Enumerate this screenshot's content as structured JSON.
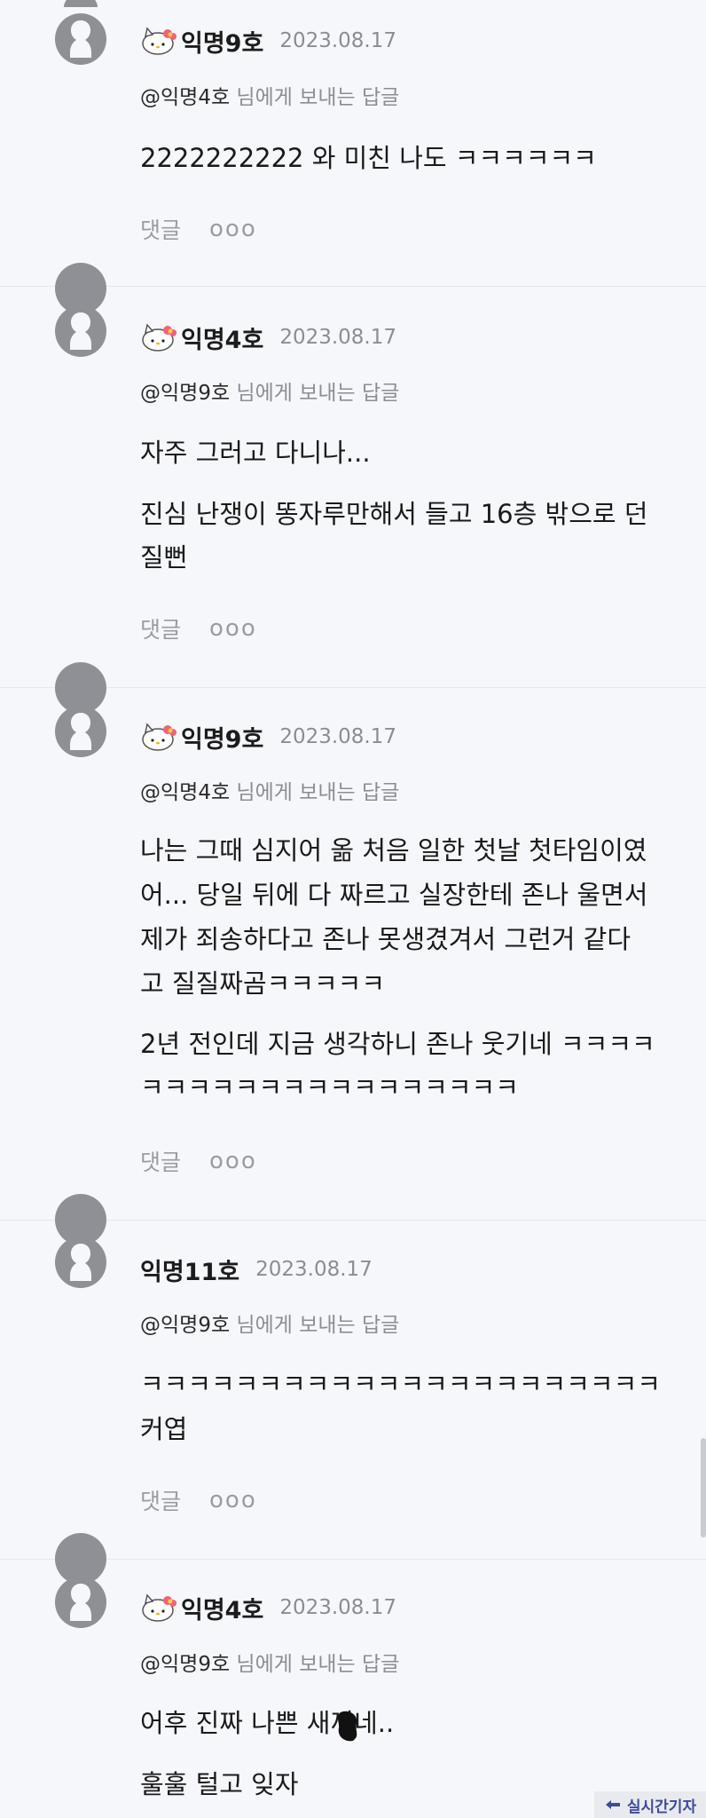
{
  "comments": [
    {
      "nickname": "익명9호",
      "date": "2023.08.17",
      "has_badge": true,
      "reply_to": "@익명4호",
      "reply_suffix": " 님에게 보내는 답글",
      "lines": [
        "2222222222 와 미친 나도 ㅋㅋㅋㅋㅋㅋ"
      ],
      "reply_label": "댓글",
      "more_label": "ooo"
    },
    {
      "nickname": "익명4호",
      "date": "2023.08.17",
      "has_badge": true,
      "reply_to": "@익명9호",
      "reply_suffix": " 님에게 보내는 답글",
      "lines": [
        "자주 그러고 다니나...",
        "진심 난쟁이 똥자루만해서 들고 16층 밖으로 던",
        "질뻔"
      ],
      "reply_label": "댓글",
      "more_label": "ooo"
    },
    {
      "nickname": "익명9호",
      "date": "2023.08.17",
      "has_badge": true,
      "reply_to": "@익명4호",
      "reply_suffix": " 님에게 보내는 답글",
      "lines": [
        "나는 그때 심지어 옮 처음 일한 첫날 첫타임이였",
        "어... 당일 뒤에 다 짜르고 실장한테 존나 울면서",
        "제가 죄송하다고 존나 못생겼겨서 그런거 같다",
        "고 질질짜곰ㅋㅋㅋㅋㅋ",
        "2년 전인데 지금 생각하니 존나 웃기네 ㅋㅋㅋㅋ",
        "ㅋㅋㅋㅋㅋㅋㅋㅋㅋㅋㅋㅋㅋㅋㅋㅋ"
      ],
      "reply_label": "댓글",
      "more_label": "ooo"
    },
    {
      "nickname": "익명11호",
      "date": "2023.08.17",
      "has_badge": false,
      "reply_to": "@익명9호",
      "reply_suffix": " 님에게 보내는 답글",
      "lines": [
        "ㅋㅋㅋㅋㅋㅋㅋㅋㅋㅋㅋㅋㅋㅋㅋㅋㅋㅋㅋㅋㅋㅋ",
        "커엽"
      ],
      "reply_label": "댓글",
      "more_label": "ooo"
    },
    {
      "nickname": "익명4호",
      "date": "2023.08.17",
      "has_badge": true,
      "reply_to": "@익명9호",
      "reply_suffix": " 님에게 보내는 답글",
      "lines": [
        "어후 진짜 나쁜 새끼네..",
        "훌훌 털고 잊자"
      ]
    }
  ],
  "watermark": "실시간기자",
  "colors": {
    "background": "#f6f7fa",
    "meta_gray": "#8a8d93",
    "avatar_gray": "#8e9096"
  }
}
